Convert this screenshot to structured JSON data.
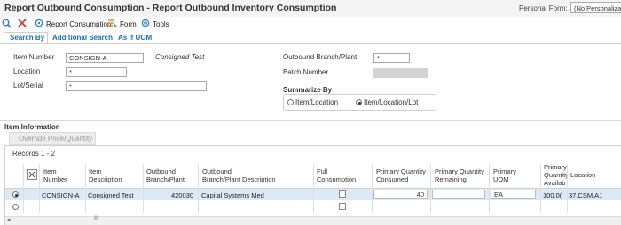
{
  "window": {
    "title": "Report Outbound Consumption - Report Outbound Inventory Consumption",
    "personal_form_label": "Personal Form:",
    "personal_form_value": "(No Personalizatio"
  },
  "toolbar": {
    "search_icon": "search-icon",
    "close_icon": "close-icon",
    "report_consumption_label": "Report Consumption",
    "form_label": "Form",
    "tools_label": "Tools"
  },
  "tabs": [
    {
      "label": "Search By"
    },
    {
      "label": "Additional Search"
    },
    {
      "label": "As If UOM"
    }
  ],
  "search": {
    "item_number_label": "Item Number",
    "item_number_value": "CONSIGN-A",
    "item_description": "Consigned Test",
    "location_label": "Location",
    "location_value": "*",
    "lot_serial_label": "Lot/Serial",
    "lot_serial_value": "*",
    "branch_plant_label": "Outbound Branch/Plant",
    "branch_plant_value": "*",
    "batch_number_label": "Batch Number",
    "summarize_label": "Summarize By",
    "summarize_options": [
      "Item/Location",
      "Item/Location/Lot"
    ],
    "summarize_selected": "Item/Location/Lot"
  },
  "item_info": {
    "section_title": "Item Information",
    "override_tab": "Override Price/Quantity",
    "records_label": "Records 1 - 2",
    "columns": [
      "Item Number",
      "Item Description",
      "Outbound Branch/Plant",
      "Outbound Branch/Plant Description",
      "Full Consumption",
      "Primary Quantity Consumed",
      "Primary Quantity Remaining",
      "Primary UOM",
      "Primary Quantity Available",
      "Location"
    ],
    "header_lines": {
      "item_number": [
        "Item",
        "Number"
      ],
      "item_description": [
        "Item",
        "Description"
      ],
      "branch_plant": [
        "Outbound",
        "Branch/Plant"
      ],
      "branch_plant_desc": [
        "Outbound",
        "Branch/Plant Description"
      ],
      "full_consumption": [
        "Full",
        "Consumption"
      ],
      "qty_consumed": [
        "Primary Quantity",
        "Consumed"
      ],
      "qty_remaining": [
        "Primary Quantity",
        "Remaining"
      ],
      "uom": [
        "Primary",
        "UOM"
      ],
      "qty_available": [
        "Primary",
        "Quantity",
        "Availab"
      ],
      "location": [
        "Location"
      ]
    },
    "rows": [
      {
        "item_number": "CONSIGN-A",
        "item_description": "Consigned Test",
        "branch_plant": "420030",
        "branch_plant_desc": "Capital Systems Med",
        "full_consumption": false,
        "qty_consumed": "40",
        "qty_remaining": "",
        "uom": "EA",
        "qty_available": "100.0(",
        "location": "37.CSM.A1",
        "selected": true
      },
      {
        "item_number": "",
        "item_description": "",
        "branch_plant": "",
        "branch_plant_desc": "",
        "full_consumption": false,
        "qty_consumed": "",
        "qty_remaining": "",
        "uom": "",
        "qty_available": "",
        "location": "",
        "selected": false
      }
    ],
    "scroll_left": "◂",
    "scroll_grip": "III"
  },
  "colors": {
    "accent_blue": "#1d6fb8",
    "selected_row": "#dceaf7",
    "toolbar_icon_blue": "#2a7fd4",
    "close_red": "#d9342b",
    "form_orange": "#e07b1f"
  }
}
